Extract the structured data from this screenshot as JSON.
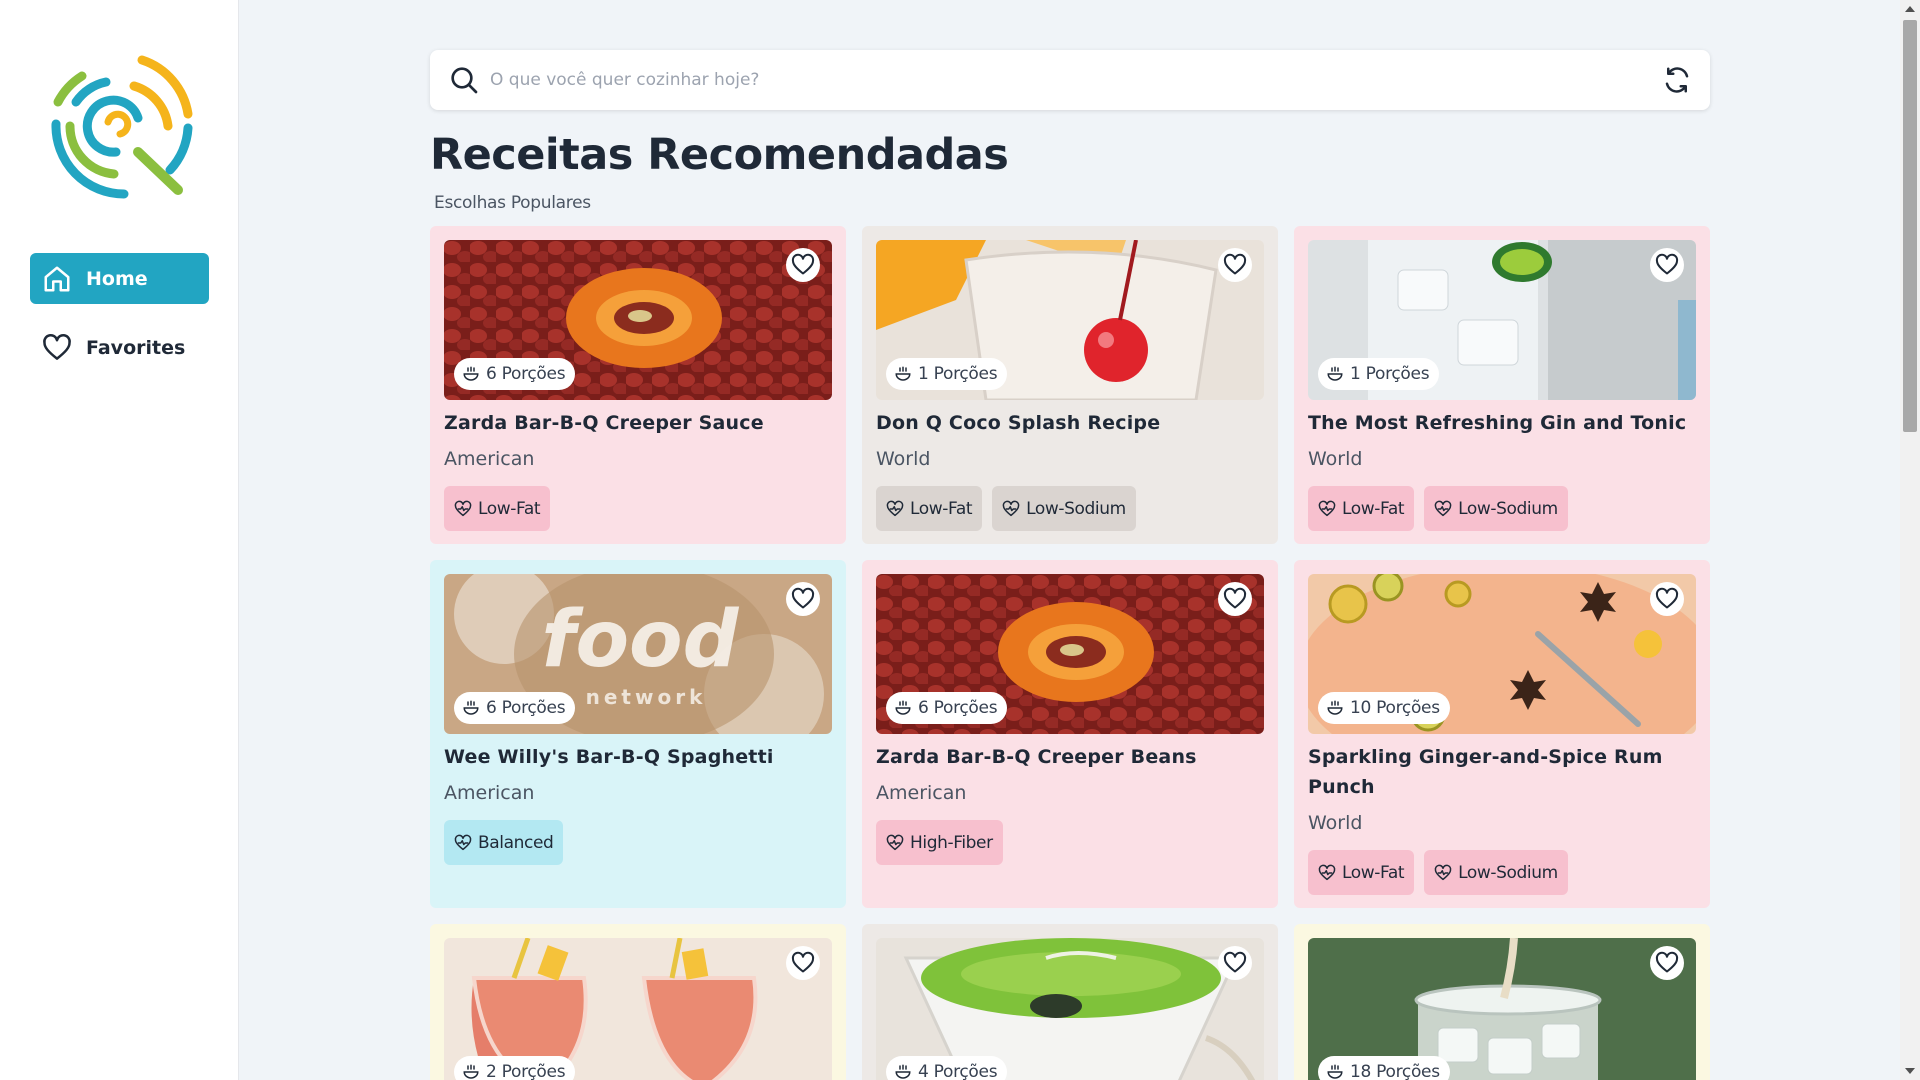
{
  "sidebar": {
    "logo": "recipe-search-logo",
    "items": [
      {
        "label": "Home",
        "icon": "home-icon",
        "active": true
      },
      {
        "label": "Favorites",
        "icon": "heart-icon",
        "active": false
      }
    ]
  },
  "search": {
    "placeholder": "O que você quer cozinhar hoje?",
    "value": ""
  },
  "main": {
    "title": "Receitas Recomendadas",
    "subtitle": "Escolhas Populares"
  },
  "colors": {
    "accent": "#22a5c2",
    "card_pink": "#fbe0e6",
    "card_gray": "#ede9e6",
    "card_cyan": "#d9f4f8",
    "card_cream": "#fbf8e1"
  },
  "recipes": [
    {
      "title": "Zarda Bar-B-Q Creeper Sauce",
      "cuisine": "American",
      "servings": "6 Porções",
      "tags": [
        "Low-Fat"
      ],
      "theme": "pink",
      "image": "roasted-pepper-ring"
    },
    {
      "title": "Don Q Coco Splash Recipe",
      "cuisine": "World",
      "servings": "1 Porções",
      "tags": [
        "Low-Fat",
        "Low-Sodium"
      ],
      "theme": "gray",
      "image": "cocktail-with-cherry"
    },
    {
      "title": "The Most Refreshing Gin and Tonic",
      "cuisine": "World",
      "servings": "1 Porções",
      "tags": [
        "Low-Fat",
        "Low-Sodium"
      ],
      "theme": "pink",
      "image": "gin-tonic-glass"
    },
    {
      "title": "Wee Willy's Bar-B-Q Spaghetti",
      "cuisine": "American",
      "servings": "6 Porções",
      "tags": [
        "Balanced"
      ],
      "theme": "cyan",
      "image": "food-network-logo"
    },
    {
      "title": "Zarda Bar-B-Q Creeper Beans",
      "cuisine": "American",
      "servings": "6 Porções",
      "tags": [
        "High-Fiber"
      ],
      "theme": "pink",
      "image": "roasted-pepper-ring"
    },
    {
      "title": "Sparkling Ginger-and-Spice Rum Punch",
      "cuisine": "World",
      "servings": "10 Porções",
      "tags": [
        "Low-Fat",
        "Low-Sodium"
      ],
      "theme": "pink",
      "image": "punch-bowl-citrus"
    },
    {
      "title": "",
      "cuisine": "",
      "servings": "2 Porções",
      "tags": [],
      "theme": "cream",
      "image": "smoothie-glasses"
    },
    {
      "title": "",
      "cuisine": "",
      "servings": "4 Porções",
      "tags": [],
      "theme": "gray",
      "image": "green-soup-bowl"
    },
    {
      "title": "",
      "cuisine": "",
      "servings": "18 Porções",
      "tags": [],
      "theme": "cream",
      "image": "iced-drink-pour"
    }
  ]
}
